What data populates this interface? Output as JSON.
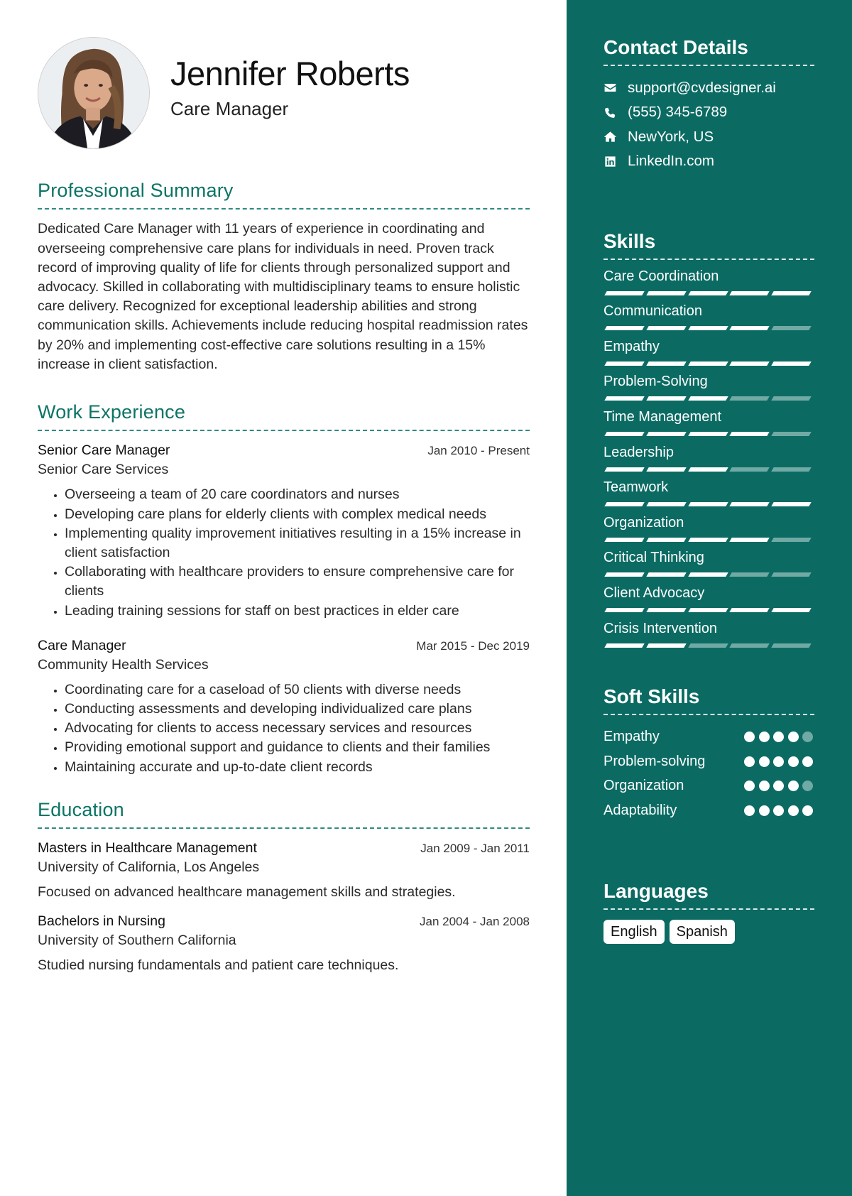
{
  "profile": {
    "name": "Jennifer Roberts",
    "title": "Care Manager",
    "photo_alt": "profile-photo"
  },
  "summary": {
    "heading": "Professional Summary",
    "text": "Dedicated Care Manager with 11 years of experience in coordinating and overseeing comprehensive care plans for individuals in need. Proven track record of improving quality of life for clients through personalized support and advocacy. Skilled in collaborating with multidisciplinary teams to ensure holistic care delivery. Recognized for exceptional leadership abilities and strong communication skills. Achievements include reducing hospital readmission rates by 20% and implementing cost-effective care solutions resulting in a 15% increase in client satisfaction."
  },
  "work": {
    "heading": "Work Experience",
    "jobs": [
      {
        "title": "Senior Care Manager",
        "dates": "Jan 2010 - Present",
        "org": "Senior Care Services",
        "bullets": [
          "Overseeing a team of 20 care coordinators and nurses",
          "Developing care plans for elderly clients with complex medical needs",
          "Implementing quality improvement initiatives resulting in a 15% increase in client satisfaction",
          "Collaborating with healthcare providers to ensure comprehensive care for clients",
          "Leading training sessions for staff on best practices in elder care"
        ]
      },
      {
        "title": "Care Manager",
        "dates": "Mar 2015 - Dec 2019",
        "org": "Community Health Services",
        "bullets": [
          "Coordinating care for a caseload of 50 clients with diverse needs",
          "Conducting assessments and developing individualized care plans",
          "Advocating for clients to access necessary services and resources",
          "Providing emotional support and guidance to clients and their families",
          "Maintaining accurate and up-to-date client records"
        ]
      }
    ]
  },
  "education": {
    "heading": "Education",
    "items": [
      {
        "degree": "Masters in Healthcare Management",
        "dates": "Jan 2009 - Jan 2011",
        "school": "University of California, Los Angeles",
        "desc": "Focused on advanced healthcare management skills and strategies."
      },
      {
        "degree": "Bachelors in Nursing",
        "dates": "Jan 2004 - Jan 2008",
        "school": "University of Southern California",
        "desc": "Studied nursing fundamentals and patient care techniques."
      }
    ]
  },
  "sidebar": {
    "colors": {
      "background": "#0b6b63",
      "accent": "#0c7466"
    },
    "contact": {
      "heading": "Contact Details",
      "items": [
        {
          "icon": "envelope-icon",
          "text": "support@cvdesigner.ai"
        },
        {
          "icon": "phone-icon",
          "text": "(555) 345-6789"
        },
        {
          "icon": "home-icon",
          "text": "NewYork, US"
        },
        {
          "icon": "linkedin-icon",
          "text": "LinkedIn.com"
        }
      ]
    },
    "skills": {
      "heading": "Skills",
      "max": 5,
      "items": [
        {
          "name": "Care Coordination",
          "level": 5
        },
        {
          "name": "Communication",
          "level": 4
        },
        {
          "name": "Empathy",
          "level": 5
        },
        {
          "name": "Problem-Solving",
          "level": 3
        },
        {
          "name": "Time Management",
          "level": 4
        },
        {
          "name": "Leadership",
          "level": 3
        },
        {
          "name": "Teamwork",
          "level": 5
        },
        {
          "name": "Organization",
          "level": 4
        },
        {
          "name": "Critical Thinking",
          "level": 3
        },
        {
          "name": "Client Advocacy",
          "level": 5
        },
        {
          "name": "Crisis Intervention",
          "level": 2
        }
      ]
    },
    "soft_skills": {
      "heading": "Soft Skills",
      "max": 5,
      "items": [
        {
          "name": "Empathy",
          "level": 4
        },
        {
          "name": "Problem-solving",
          "level": 5
        },
        {
          "name": "Organization",
          "level": 4
        },
        {
          "name": "Adaptability",
          "level": 5
        }
      ]
    },
    "languages": {
      "heading": "Languages",
      "items": [
        "English",
        "Spanish"
      ]
    }
  }
}
